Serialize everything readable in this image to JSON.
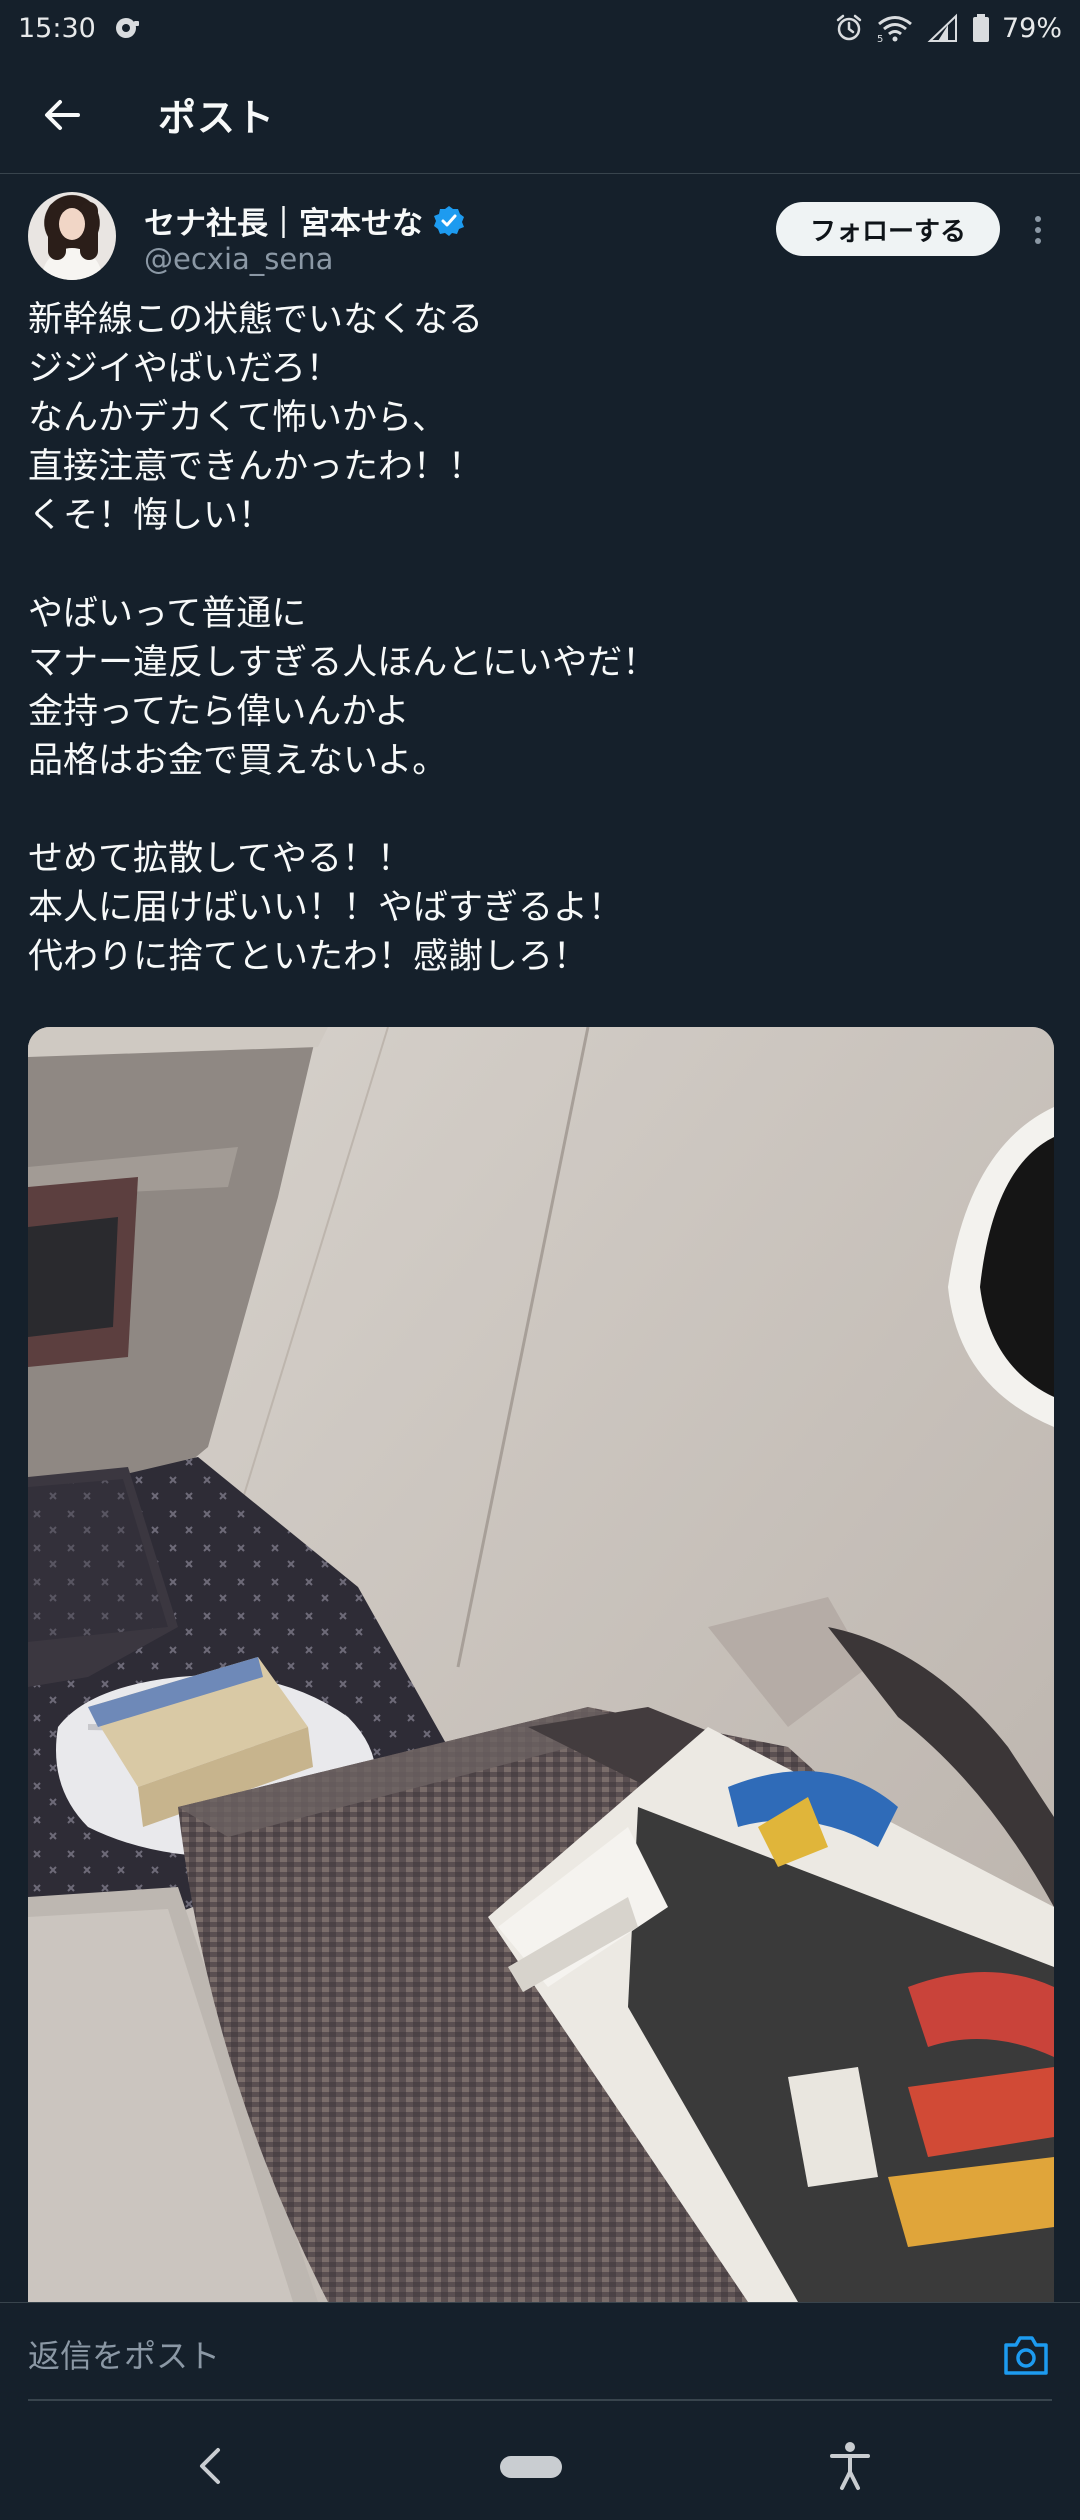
{
  "status_bar": {
    "time": "15:30",
    "battery": "79%",
    "network": "5"
  },
  "header": {
    "title": "ポスト"
  },
  "author": {
    "display_name": "セナ社長｜宮本せな",
    "handle": "@ecxia_sena",
    "verified": true,
    "follow_label": "フォローする"
  },
  "post": {
    "lines": [
      "新幹線この状態でいなくなる",
      "ジジイやばいだろ！",
      "なんかデカくて怖いから、",
      "直接注意できんかったわ！！",
      "くそ！悔しい！",
      "",
      "やばいって普通に",
      "マナー違反しすぎる人ほんとにいやだ！",
      "金持ってたら偉いんかよ",
      "品格はお金で買えないよ。",
      "",
      "せめて拡散してやる！！",
      "本人に届けばいい！！やばすぎるよ！",
      "代わりに捨てといたわ！感謝しろ！"
    ],
    "image_alt": "Shinkansen seat area with a plastic bag, a box and a newspaper left behind"
  },
  "reply": {
    "placeholder": "返信をポスト"
  },
  "colors": {
    "background": "#15202b",
    "text_primary": "#f7f9f9",
    "text_secondary": "#8b98a5",
    "accent": "#1d9bf0",
    "divider": "#38444d"
  },
  "icons": {
    "back": "arrow-left-icon",
    "verified": "verified-badge-icon",
    "more": "more-vertical-icon",
    "camera": "camera-icon",
    "nav_back": "chevron-left-icon",
    "accessibility": "accessibility-icon"
  }
}
